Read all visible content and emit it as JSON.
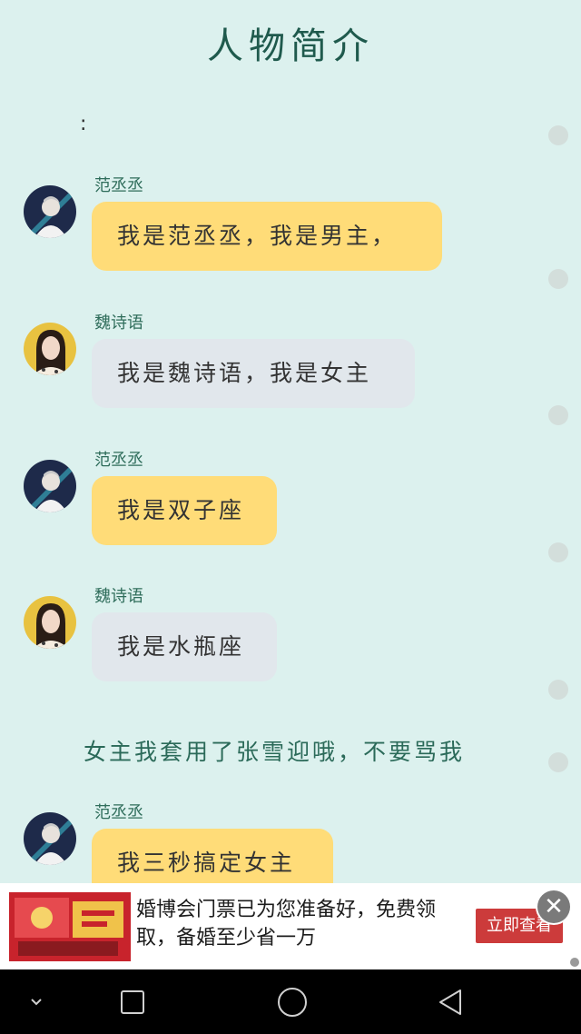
{
  "page": {
    "title": "人物简介",
    "colon": ":"
  },
  "messages": [
    {
      "sender": "范丞丞",
      "text": "我是范丞丞，我是男主，",
      "style": "yellow",
      "avatar": "male-avatar"
    },
    {
      "sender": "魏诗语",
      "text": "我是魏诗语，我是女主",
      "style": "gray",
      "avatar": "female-avatar"
    },
    {
      "sender": "范丞丞",
      "text": "我是双子座",
      "style": "yellow",
      "avatar": "male-avatar"
    },
    {
      "sender": "魏诗语",
      "text": "我是水瓶座",
      "style": "gray",
      "avatar": "female-avatar"
    },
    {
      "sender": "范丞丞",
      "text": "我三秒搞定女主",
      "style": "yellow",
      "avatar": "male-avatar"
    }
  ],
  "note": "女主我套用了张雪迎哦，不要骂我",
  "ad": {
    "text": "婚博会门票已为您准备好，免费领取，备婚至少省一万",
    "button": "立即查看",
    "close_icon": "close-icon"
  },
  "navbar": {
    "items": [
      "chevron-down-icon",
      "recent-apps-icon",
      "home-icon",
      "back-icon"
    ]
  },
  "colors": {
    "background": "#dcf1ee",
    "bubble_yellow": "#ffdc78",
    "bubble_gray": "#e1e7ec",
    "title": "#1f5a4d",
    "ad_button": "#cc3b3b"
  }
}
